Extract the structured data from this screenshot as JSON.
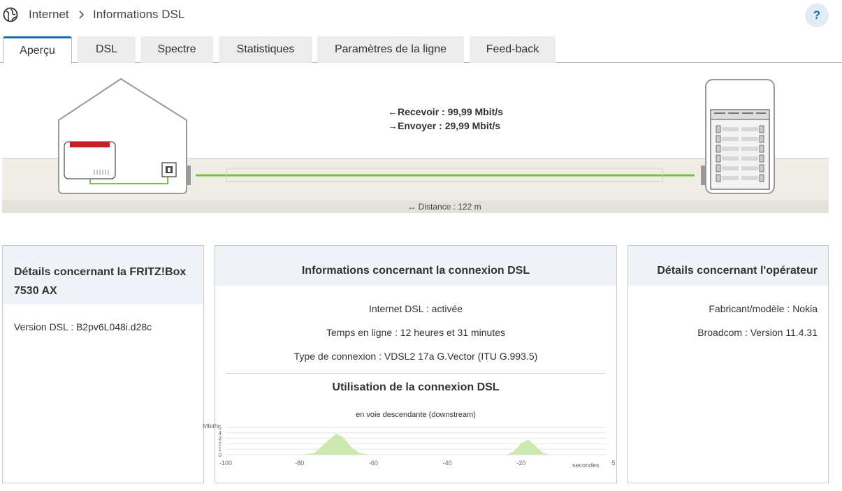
{
  "breadcrumb": {
    "root": "Internet",
    "current": "Informations DSL"
  },
  "help_label": "?",
  "tabs": [
    {
      "label": "Aperçu",
      "active": true
    },
    {
      "label": "DSL"
    },
    {
      "label": "Spectre"
    },
    {
      "label": "Statistiques"
    },
    {
      "label": "Paramètres de la ligne"
    },
    {
      "label": "Feed-back"
    }
  ],
  "overview": {
    "receive": "Recevoir : 99,99 Mbit/s",
    "send": "Envoyer : 29,99 Mbit/s",
    "distance": "Distance : 122 m"
  },
  "fritzbox_panel": {
    "title": "Détails concernant la FRITZ!Box 7530 AX",
    "version": "Version DSL : B2pv6L048i.d28c"
  },
  "connection_panel": {
    "title": "Informations concernant la connexion DSL",
    "status": "Internet DSL : activée",
    "uptime": "Temps en ligne : 12 heures et 31 minutes",
    "type": "Type de connexion : VDSL2 17a G.Vector (ITU G.993.5)",
    "usage_title": "Utilisation de la connexion DSL",
    "usage_subtitle": "en voie descendante (downstream)"
  },
  "operator_panel": {
    "title": "Détails concernant l'opérateur",
    "vendor": "Fabricant/modèle : Nokia",
    "broadcom": "Broadcom : Version 11.4.31"
  },
  "colors": {
    "accent": "#1b6db5",
    "line": "#7cc242",
    "router_red": "#c81e28",
    "area": "#cde8b0"
  },
  "chart_data": {
    "type": "area",
    "ylabel": "Mbit/s",
    "xlabel": "secondes",
    "xlim": [
      -100,
      5
    ],
    "ylim": [
      0,
      5
    ],
    "y_ticks": [
      0,
      1,
      2,
      3,
      4,
      5
    ],
    "x_ticks": [
      -100,
      -80,
      -60,
      -40,
      -20,
      5
    ],
    "x": [
      -100,
      -80,
      -76,
      -72,
      -70,
      -68,
      -66,
      -64,
      -62,
      -60,
      -24,
      -22,
      -20,
      -18,
      -16,
      -14,
      -12,
      0,
      5
    ],
    "values": [
      0,
      0,
      0.3,
      2.8,
      3.9,
      3.1,
      1.4,
      0.4,
      0.1,
      0,
      0,
      0.6,
      2.1,
      2.8,
      1.5,
      0.3,
      0,
      0,
      0
    ]
  }
}
